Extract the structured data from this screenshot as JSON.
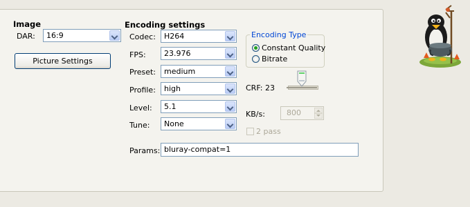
{
  "image_section": {
    "title": "Image",
    "dar_label": "DAR:",
    "dar_value": "16:9",
    "picture_settings_button": "Picture Settings"
  },
  "encoding": {
    "title": "Encoding settings",
    "codec_label": "Codec:",
    "codec_value": "H264",
    "fps_label": "FPS:",
    "fps_value": "23.976",
    "preset_label": "Preset:",
    "preset_value": "medium",
    "profile_label": "Profile:",
    "profile_value": "high",
    "level_label": "Level:",
    "level_value": "5.1",
    "tune_label": "Tune:",
    "tune_value": "None",
    "params_label": "Params:",
    "params_value": "bluray-compat=1"
  },
  "encoding_type": {
    "title": "Encoding Type",
    "options": [
      "Constant Quality",
      "Bitrate"
    ],
    "selected": "Constant Quality"
  },
  "crf": {
    "label": "CRF: 23"
  },
  "bitrate": {
    "label": "KB/s:",
    "value": "800",
    "two_pass_label": "2 pass"
  },
  "colors": {
    "accent": "#0046d5",
    "panel": "#f4f3ee",
    "background": "#eceae3"
  }
}
